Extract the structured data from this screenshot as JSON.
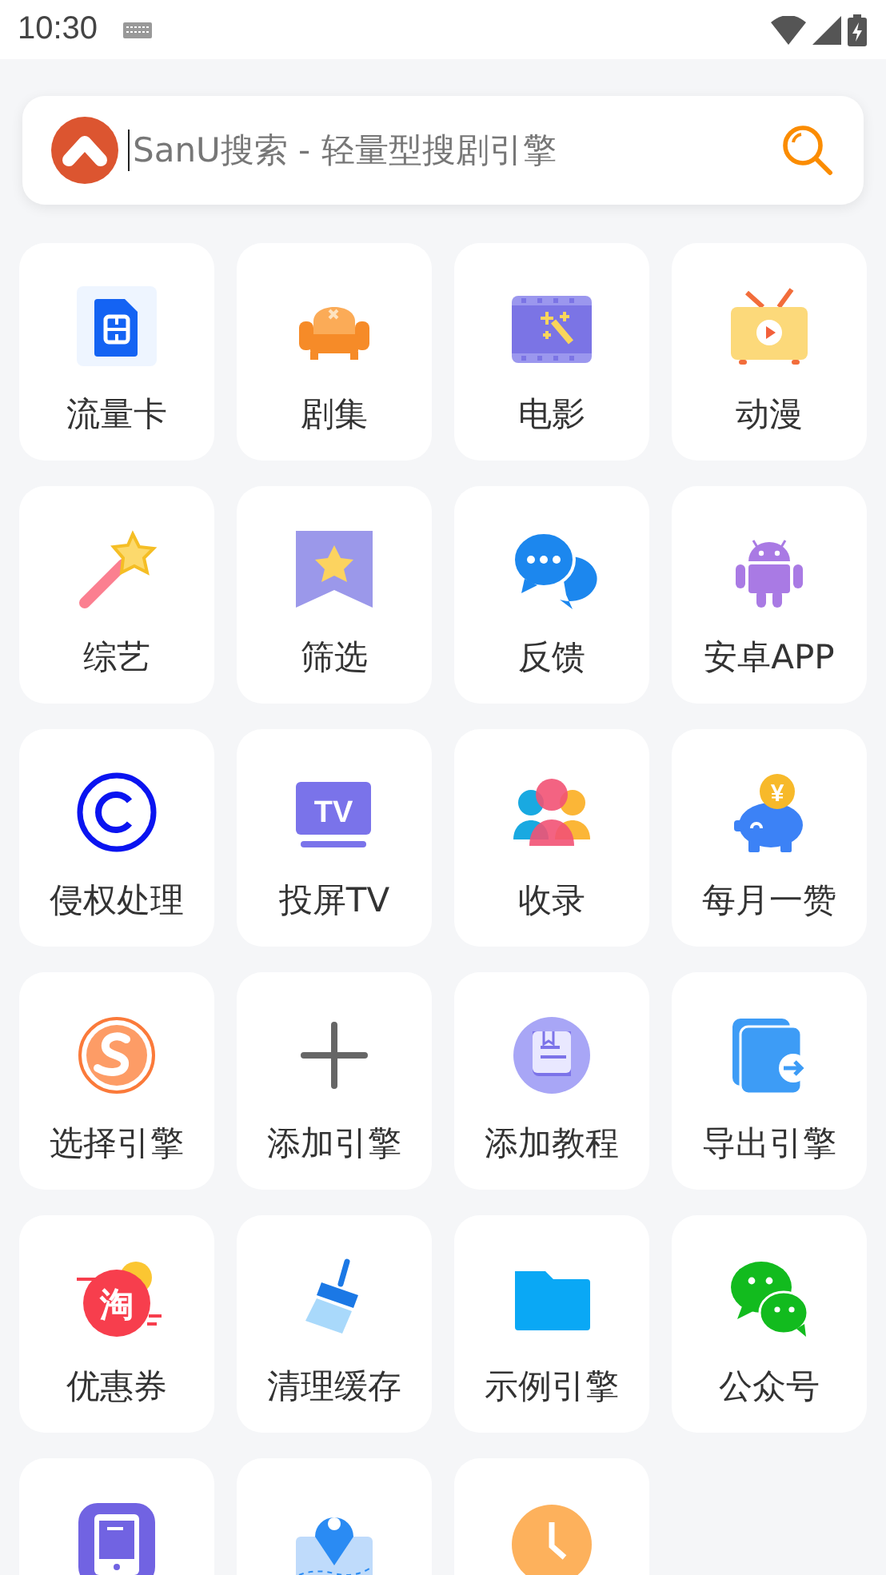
{
  "status_bar": {
    "time": "10:30"
  },
  "search": {
    "placeholder": "SanU搜索 - 轻量型搜剧引擎"
  },
  "tiles": [
    {
      "kind": "sim",
      "label": "流量卡"
    },
    {
      "kind": "sofa",
      "label": "剧集"
    },
    {
      "kind": "film",
      "label": "电影"
    },
    {
      "kind": "tv",
      "label": "动漫"
    },
    {
      "kind": "wand",
      "label": "综艺"
    },
    {
      "kind": "bookmark",
      "label": "筛选"
    },
    {
      "kind": "chat",
      "label": "反馈"
    },
    {
      "kind": "android",
      "label": "安卓APP"
    },
    {
      "kind": "copyright",
      "label": "侵权处理"
    },
    {
      "kind": "cast",
      "label": "投屏TV",
      "icon_text": "TV"
    },
    {
      "kind": "people",
      "label": "收录"
    },
    {
      "kind": "piggy",
      "label": "每月一赞",
      "icon_text": "¥"
    },
    {
      "kind": "slogo",
      "label": "选择引擎"
    },
    {
      "kind": "plus",
      "label": "添加引擎"
    },
    {
      "kind": "book",
      "label": "添加教程"
    },
    {
      "kind": "export",
      "label": "导出引擎"
    },
    {
      "kind": "coupon",
      "label": "优惠券",
      "icon_text": "淘"
    },
    {
      "kind": "broom",
      "label": "清理缓存"
    },
    {
      "kind": "folder",
      "label": "示例引擎"
    },
    {
      "kind": "wechat",
      "label": "公众号"
    },
    {
      "kind": "phone"
    },
    {
      "kind": "map"
    },
    {
      "kind": "clock"
    }
  ]
}
